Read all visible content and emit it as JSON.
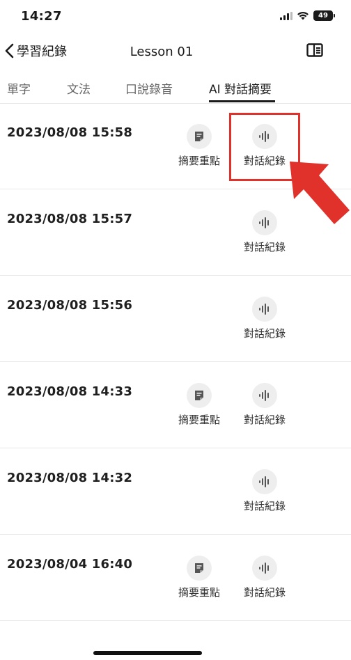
{
  "status_bar": {
    "time": "14:27",
    "battery": "49"
  },
  "nav": {
    "back_label": "學習紀錄",
    "title": "Lesson 01"
  },
  "tabs": [
    {
      "label": "單字",
      "active": false
    },
    {
      "label": "文法",
      "active": false
    },
    {
      "label": "口說錄音",
      "active": false
    },
    {
      "label": "AI 對話摘要",
      "active": true
    }
  ],
  "records": [
    {
      "datetime": "2023/08/08 15:58",
      "summary_label": "摘要重點",
      "record_label": "對話紀錄",
      "has_summary": true
    },
    {
      "datetime": "2023/08/08 15:57",
      "record_label": "對話紀錄",
      "has_summary": false
    },
    {
      "datetime": "2023/08/08 15:56",
      "record_label": "對話紀錄",
      "has_summary": false
    },
    {
      "datetime": "2023/08/08 14:33",
      "summary_label": "摘要重點",
      "record_label": "對話紀錄",
      "has_summary": true
    },
    {
      "datetime": "2023/08/08 14:32",
      "record_label": "對話紀錄",
      "has_summary": false
    },
    {
      "datetime": "2023/08/04 16:40",
      "summary_label": "摘要重點",
      "record_label": "對話紀錄",
      "has_summary": true
    }
  ],
  "colors": {
    "highlight": "#e0312a",
    "icon_bg": "#eeeeee"
  },
  "icons": {
    "back": "chevron-left-icon",
    "panel": "side-panel-icon",
    "summary": "note-icon",
    "record": "audio-wave-icon"
  }
}
